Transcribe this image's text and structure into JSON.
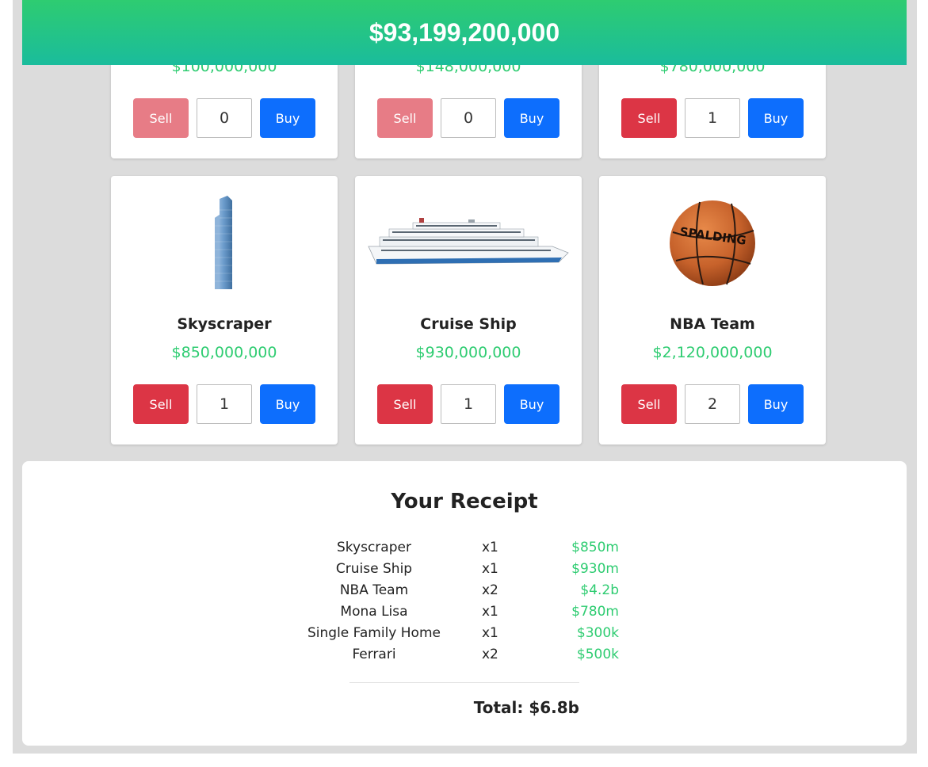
{
  "balance": "$93,199,200,000",
  "top_row": [
    {
      "price": "$100,000,000",
      "quantity": "0",
      "sell_label": "Sell",
      "buy_label": "Buy",
      "sell_enabled": false
    },
    {
      "price": "$148,000,000",
      "quantity": "0",
      "sell_label": "Sell",
      "buy_label": "Buy",
      "sell_enabled": false
    },
    {
      "price": "$780,000,000",
      "quantity": "1",
      "sell_label": "Sell",
      "buy_label": "Buy",
      "sell_enabled": true
    }
  ],
  "products": [
    {
      "name": "Skyscraper",
      "price": "$850,000,000",
      "quantity": "1",
      "sell_label": "Sell",
      "buy_label": "Buy",
      "icon": "skyscraper-icon"
    },
    {
      "name": "Cruise Ship",
      "price": "$930,000,000",
      "quantity": "1",
      "sell_label": "Sell",
      "buy_label": "Buy",
      "icon": "cruise-ship-icon"
    },
    {
      "name": "NBA Team",
      "price": "$2,120,000,000",
      "quantity": "2",
      "sell_label": "Sell",
      "buy_label": "Buy",
      "icon": "basketball-icon",
      "ball_brand": "SPALDING"
    }
  ],
  "receipt": {
    "title": "Your Receipt",
    "items": [
      {
        "name": "Skyscraper",
        "qty": "x1",
        "amount": "$850m"
      },
      {
        "name": "Cruise Ship",
        "qty": "x1",
        "amount": "$930m"
      },
      {
        "name": "NBA Team",
        "qty": "x2",
        "amount": "$4.2b"
      },
      {
        "name": "Mona Lisa",
        "qty": "x1",
        "amount": "$780m"
      },
      {
        "name": "Single Family Home",
        "qty": "x1",
        "amount": "$300k"
      },
      {
        "name": "Ferrari",
        "qty": "x2",
        "amount": "$500k"
      }
    ],
    "total": "Total: $6.8b"
  },
  "colors": {
    "accent_green": "#2ecc71",
    "sell_red": "#dc3545",
    "sell_disabled": "#e77c86",
    "buy_blue": "#0d6efd"
  }
}
